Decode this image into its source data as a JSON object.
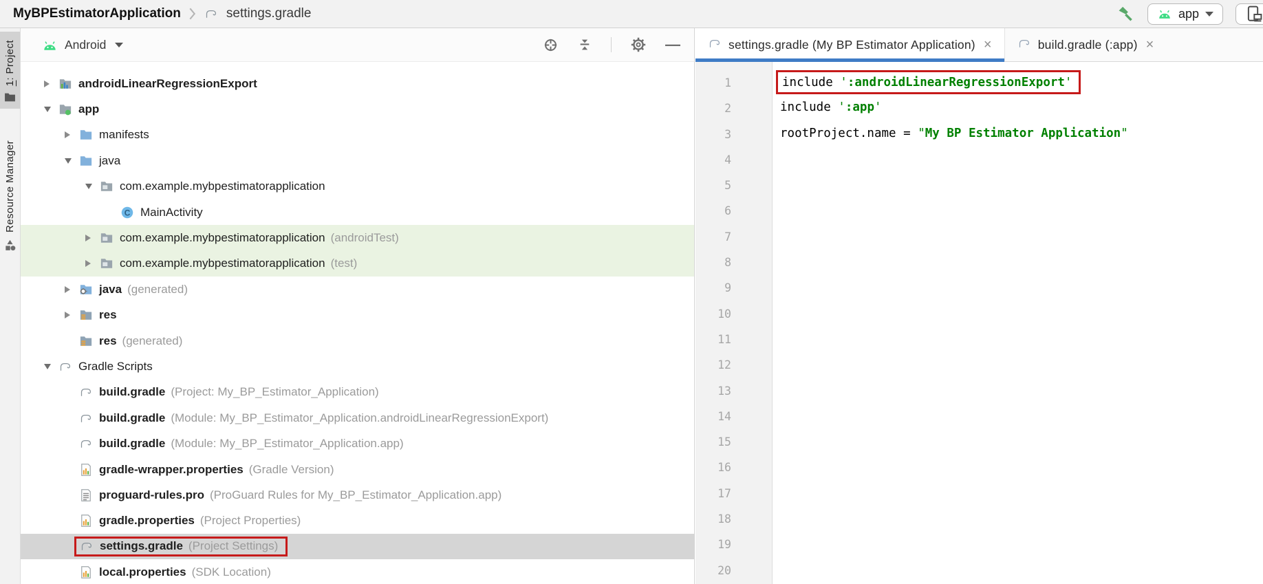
{
  "breadcrumb": {
    "project": "MyBPEstimatorApplication",
    "file": "settings.gradle"
  },
  "toolbar": {
    "run_config_label": "app"
  },
  "left_stripe": {
    "project_tab": {
      "mnemonic": "1",
      "rest": ": Project"
    },
    "resource_manager_tab": "Resource Manager"
  },
  "tool_window": {
    "title": "Android"
  },
  "tree": {
    "items": [
      {
        "indent": 0,
        "arrow": "right",
        "icon": "module-folder-icon",
        "label": "androidLinearRegressionExport",
        "bold": true
      },
      {
        "indent": 0,
        "arrow": "down",
        "icon": "android-module-folder-icon",
        "label": "app",
        "bold": true
      },
      {
        "indent": 1,
        "arrow": "right",
        "icon": "folder-icon",
        "label": "manifests"
      },
      {
        "indent": 1,
        "arrow": "down",
        "icon": "folder-icon",
        "label": "java"
      },
      {
        "indent": 2,
        "arrow": "down",
        "icon": "package-icon",
        "label": "com.example.mybpestimatorapplication"
      },
      {
        "indent": 3,
        "arrow": "none",
        "icon": "class-icon",
        "label": "MainActivity"
      },
      {
        "indent": 2,
        "arrow": "right",
        "icon": "package-icon",
        "label": "com.example.mybpestimatorapplication",
        "annotation": "(androidTest)",
        "bg": "green"
      },
      {
        "indent": 2,
        "arrow": "right",
        "icon": "package-icon",
        "label": "com.example.mybpestimatorapplication",
        "annotation": "(test)",
        "bg": "green"
      },
      {
        "indent": 1,
        "arrow": "right",
        "icon": "generated-java-folder-icon",
        "label": "java",
        "annotation": "(generated)",
        "bold": true
      },
      {
        "indent": 1,
        "arrow": "right",
        "icon": "res-folder-icon",
        "label": "res",
        "bold": true
      },
      {
        "indent": 1,
        "arrow": "none",
        "icon": "res-folder-icon",
        "label": "res",
        "annotation": "(generated)",
        "bold": true
      },
      {
        "indent": 0,
        "arrow": "down",
        "icon": "gradle-icon",
        "label": "Gradle Scripts"
      },
      {
        "indent": 1,
        "arrow": "none",
        "icon": "gradle-icon",
        "label": "build.gradle",
        "annotation": "(Project: My_BP_Estimator_Application)",
        "bold": true
      },
      {
        "indent": 1,
        "arrow": "none",
        "icon": "gradle-icon",
        "label": "build.gradle",
        "annotation": "(Module: My_BP_Estimator_Application.androidLinearRegressionExport)",
        "bold": true
      },
      {
        "indent": 1,
        "arrow": "none",
        "icon": "gradle-icon",
        "label": "build.gradle",
        "annotation": "(Module: My_BP_Estimator_Application.app)",
        "bold": true
      },
      {
        "indent": 1,
        "arrow": "none",
        "icon": "properties-icon",
        "label": "gradle-wrapper.properties",
        "annotation": "(Gradle Version)",
        "bold": true
      },
      {
        "indent": 1,
        "arrow": "none",
        "icon": "proguard-icon",
        "label": "proguard-rules.pro",
        "annotation": "(ProGuard Rules for My_BP_Estimator_Application.app)",
        "bold": true
      },
      {
        "indent": 1,
        "arrow": "none",
        "icon": "properties-icon",
        "label": "gradle.properties",
        "annotation": "(Project Properties)",
        "bold": true
      },
      {
        "indent": 1,
        "arrow": "none",
        "icon": "gradle-icon",
        "label": "settings.gradle",
        "annotation": "(Project Settings)",
        "bold": true,
        "bg": "selected",
        "red_box": true
      },
      {
        "indent": 1,
        "arrow": "none",
        "icon": "properties-icon",
        "label": "local.properties",
        "annotation": "(SDK Location)",
        "bold": true
      }
    ]
  },
  "editor": {
    "tabs": [
      {
        "label": "settings.gradle (My BP Estimator Application)",
        "active": true
      },
      {
        "label": "build.gradle (:app)",
        "active": false
      }
    ],
    "total_lines": 20,
    "lines": [
      {
        "n": 1,
        "boxed": true,
        "segs": [
          [
            "plain",
            "include "
          ],
          [
            "str",
            "'"
          ],
          [
            "strb",
            ":androidLinearRegressionExport"
          ],
          [
            "str",
            "'"
          ]
        ]
      },
      {
        "n": 2,
        "segs": [
          [
            "plain",
            "include "
          ],
          [
            "str",
            "'"
          ],
          [
            "strb",
            ":app"
          ],
          [
            "str",
            "'"
          ]
        ]
      },
      {
        "n": 3,
        "segs": [
          [
            "plain",
            "rootProject.name = "
          ],
          [
            "str",
            "\""
          ],
          [
            "strb",
            "My BP Estimator Application"
          ],
          [
            "str",
            "\""
          ]
        ]
      }
    ]
  },
  "icon_names": [
    "gradle-icon",
    "folder-icon",
    "package-icon",
    "module-folder-icon",
    "android-module-folder-icon",
    "res-folder-icon",
    "generated-java-folder-icon",
    "class-icon",
    "properties-icon",
    "proguard-icon",
    "android-head-icon",
    "hammer-icon",
    "device-icon",
    "target-icon",
    "collapse-all-icon",
    "gear-icon",
    "minimize-icon",
    "close-icon",
    "chevron-icon",
    "folder-stripe-icon",
    "shapes-icon"
  ],
  "colors": {
    "tab_underline": "#3f7cc6",
    "string_green": "#008000",
    "highlight_red": "#c61a1a",
    "row_selected_gray": "#d5d5d5",
    "row_test_green": "#eaf3e2",
    "android_green": "#3ddc84",
    "hammer_green": "#59a869",
    "topbar_gray": "#f2f2f2"
  }
}
